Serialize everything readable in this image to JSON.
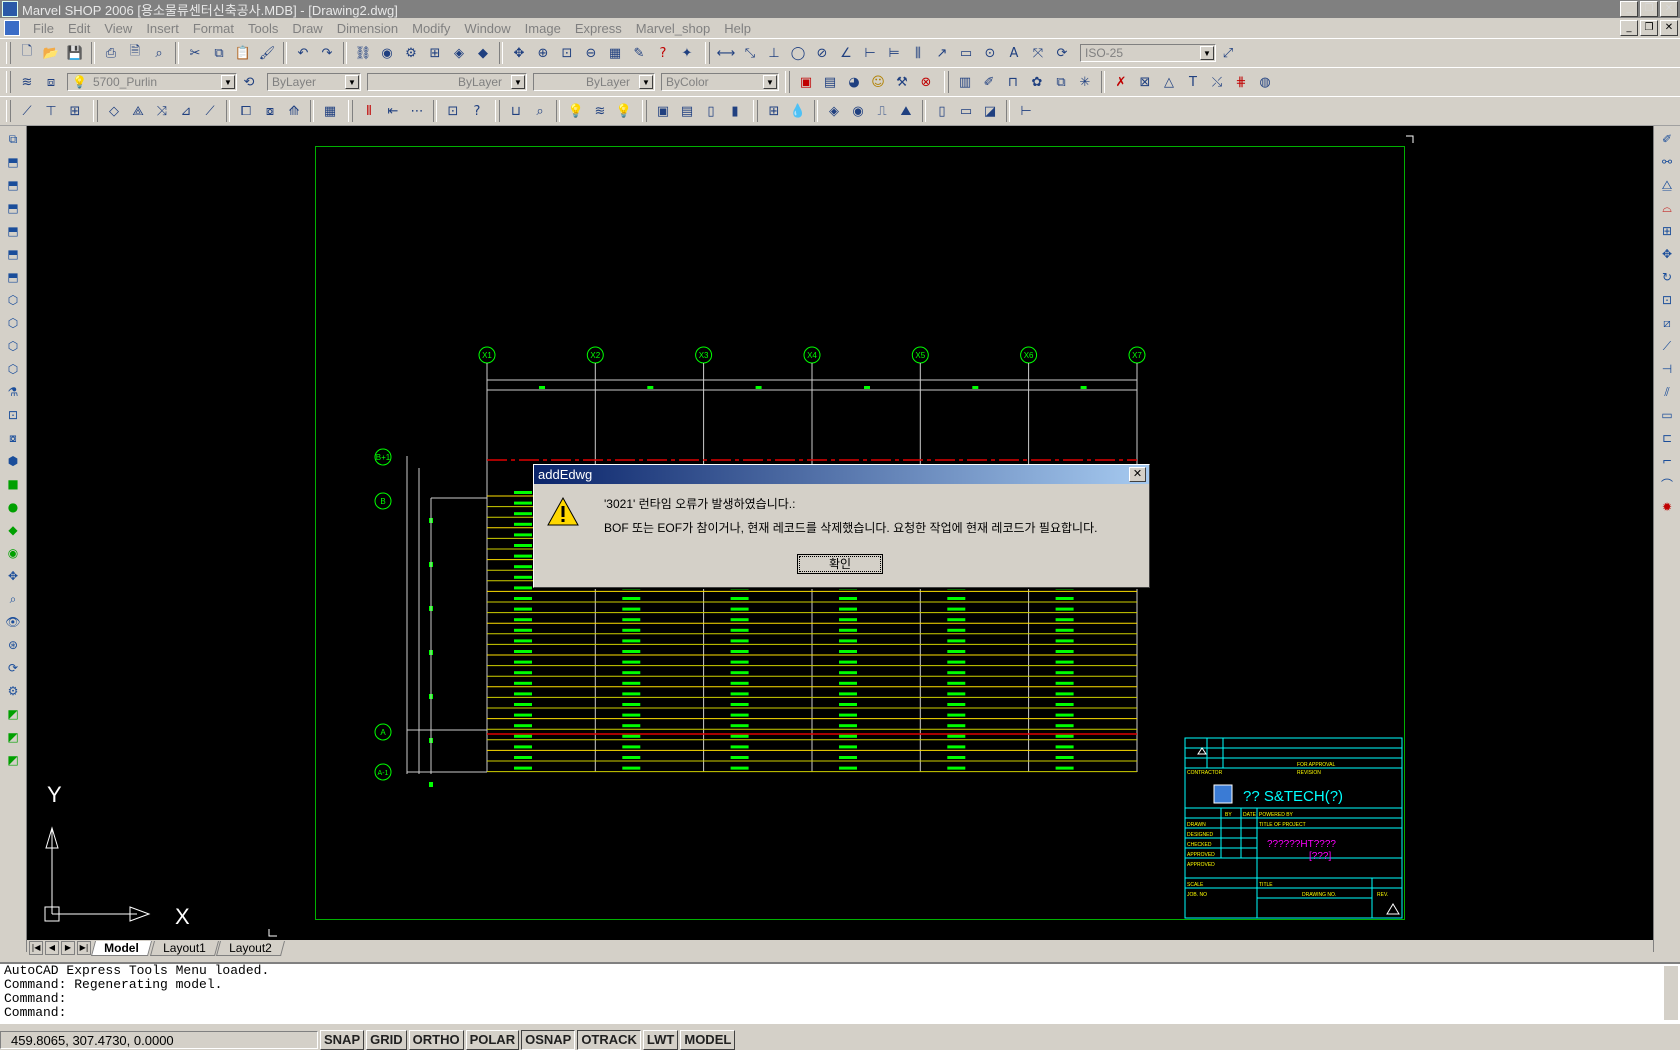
{
  "app": {
    "title": "Marvel SHOP 2006 [용소물류센터신축공사.MDB] - [Drawing2.dwg]"
  },
  "menu": [
    "File",
    "Edit",
    "View",
    "Insert",
    "Format",
    "Tools",
    "Draw",
    "Dimension",
    "Modify",
    "Window",
    "Image",
    "Express",
    "Marvel_shop",
    "Help"
  ],
  "toolbar": {
    "dimstyle": "ISO-25",
    "layer": "5700_Purlin",
    "color": "ByLayer",
    "linetype": "ByLayer",
    "lineweight": "ByLayer",
    "plotstyle": "ByColor"
  },
  "drawing": {
    "grid_labels": [
      "X1",
      "X2",
      "X3",
      "X4",
      "X5",
      "X6",
      "X7"
    ],
    "row_labels": [
      "B+1",
      "B",
      "A",
      "A-1"
    ],
    "title_block": {
      "company": "?? S&TECH(?)",
      "project": "??????HT????",
      "project_sub": "[???]",
      "labels": [
        "DRAWN",
        "DESIGNED",
        "CHECKED",
        "APPROVED",
        "APPROVED",
        "SCALE",
        "JOB. NO",
        "DRAWING NO.",
        "REV.",
        "TITLE",
        "TITLE OF PROJECT",
        "POWERED BY",
        "BY",
        "DATE",
        "FOR APPROVAL",
        "REVISION",
        "CONTRACTOR"
      ]
    },
    "ucs": {
      "x": "X",
      "y": "Y"
    }
  },
  "tabs": [
    "Model",
    "Layout1",
    "Layout2"
  ],
  "command": {
    "lines": [
      "AutoCAD Express Tools Menu loaded.",
      "Command: Regenerating model.",
      "Command:",
      "Command:"
    ]
  },
  "status": {
    "coords": "459.8065, 307.4730, 0.0000",
    "buttons": [
      "SNAP",
      "GRID",
      "ORTHO",
      "POLAR",
      "OSNAP",
      "OTRACK",
      "LWT",
      "MODEL"
    ]
  },
  "dialog": {
    "title": "addEdwg",
    "message1": "'3021' 런타임 오류가 발생하였습니다.:",
    "message2": "BOF 또는 EOF가 참이거나, 현재 레코드를 삭제했습니다. 요청한 작업에 현재 레코드가 필요합니다.",
    "ok": "확인"
  }
}
